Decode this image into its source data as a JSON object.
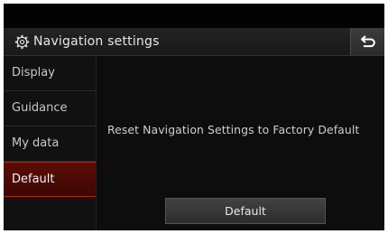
{
  "header": {
    "title": "Navigation settings",
    "icon": "gear-icon",
    "back_icon": "back-arrow-icon"
  },
  "sidebar": {
    "items": [
      {
        "label": "Display",
        "selected": false
      },
      {
        "label": "Guidance",
        "selected": false
      },
      {
        "label": "My data",
        "selected": false
      },
      {
        "label": "Default",
        "selected": true
      }
    ]
  },
  "main": {
    "message": "Reset Navigation Settings to Factory Default",
    "button_label": "Default"
  },
  "colors": {
    "background": "#0c0c0c",
    "selected_item": "#4a0a05",
    "selected_border": "#a12a14",
    "text": "#d0d0d0"
  }
}
